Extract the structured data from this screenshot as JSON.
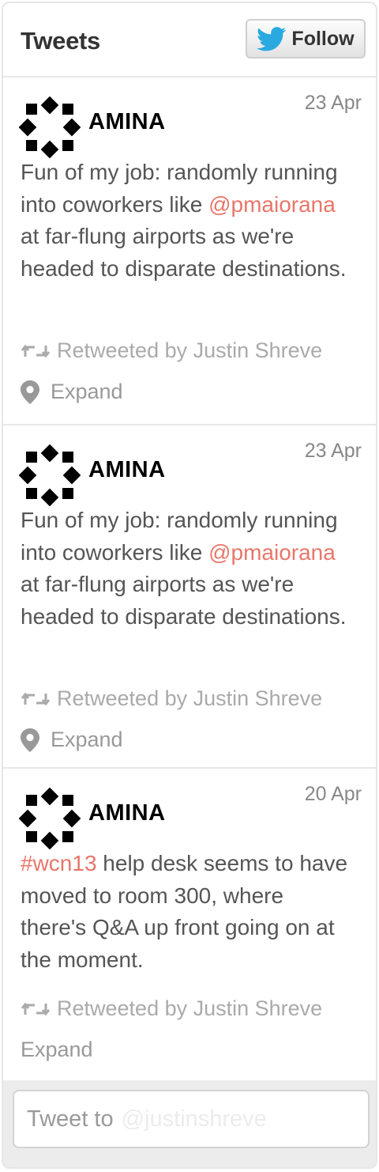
{
  "header": {
    "title": "Tweets",
    "follow_label": "Follow"
  },
  "tweets": [
    {
      "author": "AMINA",
      "date": "23 Apr",
      "text_parts": [
        {
          "t": "Fun of my job: randomly running into coworkers like ",
          "k": "text"
        },
        {
          "t": "@pmaiorana",
          "k": "mention"
        },
        {
          "t": " at far-flung airports as we're headed to disparate destinations.",
          "k": "text"
        }
      ],
      "retweet": "Retweeted by Justin Shreve",
      "expand": "Expand"
    },
    {
      "author": "AMINA",
      "date": "23 Apr",
      "text_parts": [
        {
          "t": "Fun of my job: randomly running into coworkers like ",
          "k": "text"
        },
        {
          "t": "@pmaiorana",
          "k": "mention"
        },
        {
          "t": " at far-flung airports as we're headed to disparate destinations.",
          "k": "text"
        }
      ],
      "retweet": "Retweeted by Justin Shreve",
      "expand": "Expand"
    },
    {
      "author": "AMINA",
      "date": "20 Apr",
      "text_parts": [
        {
          "t": "#wcn13",
          "k": "hashtag"
        },
        {
          "t": " help desk seems to have moved to room 300, where there's Q&A up front going on at the moment.",
          "k": "text"
        }
      ],
      "retweet": "Retweeted by Justin Shreve",
      "expand": "Expand"
    }
  ],
  "compose": {
    "prefix": "Tweet to",
    "handle": "@justinshreve"
  },
  "icons": {
    "follow": "twitter-bird-icon",
    "avatar": "amina-logo-icon",
    "retweet": "retweet-icon",
    "expand": "location-pin-icon"
  },
  "colors": {
    "link": "#e8766a",
    "bird": "#2aa9e0"
  }
}
